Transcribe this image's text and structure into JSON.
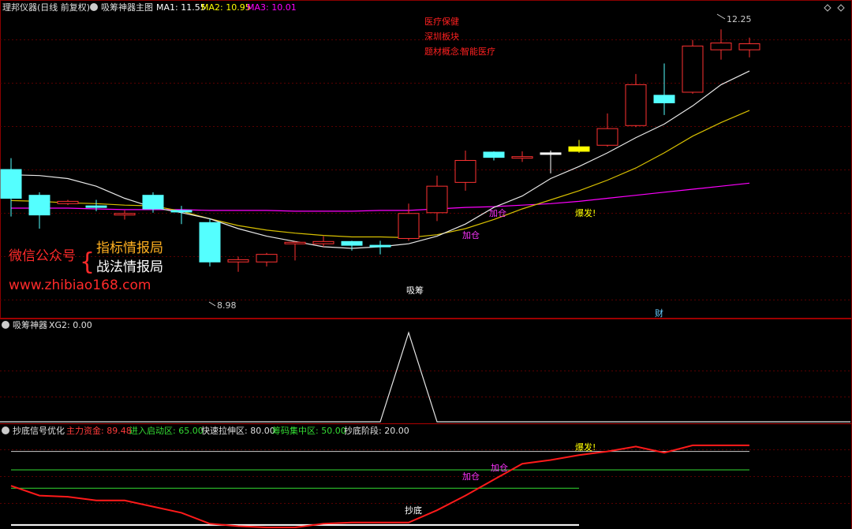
{
  "header": {
    "title": "理邦仪器(日线 前复权)",
    "indicator": "吸筹神器主图",
    "ma1": {
      "label": "MA1: 11.55",
      "color": "#ffffff"
    },
    "ma2": {
      "label": "MA2: 10.95",
      "color": "#ffff00"
    },
    "ma3": {
      "label": "MA3: 10.01",
      "color": "#ff00ff"
    }
  },
  "concepts": [
    "医疗保健",
    "深圳板块",
    "智能医疗"
  ],
  "concept_prefix": "题材概念:",
  "watermark": {
    "line1": "微信公众号",
    "brace": "{",
    "line2a": "指标情报局",
    "line2b": "战法情报局",
    "url": "www.zhibiao168.com"
  },
  "price_labels": {
    "high": "12.25",
    "low": "8.98"
  },
  "signals": {
    "xichou": "吸筹",
    "jiacang": "加仓",
    "baofa": "爆发!",
    "cai": "财",
    "chaodi": "抄底"
  },
  "panel2": {
    "title": "吸筹神器",
    "xg2": "XG2: 0.00"
  },
  "panel3": {
    "title": "抄底信号优化",
    "items": [
      {
        "label": "主力资金: 89.48",
        "color": "#ff3b3b"
      },
      {
        "label": "进入启动区: 65.00",
        "color": "#33dd33"
      },
      {
        "label": "快速拉伸区: 80.00",
        "color": "#e0e0e0"
      },
      {
        "label": "筹码集中区: 50.00",
        "color": "#33dd33"
      },
      {
        "label": "抄底阶段: 20.00",
        "color": "#e0e0e0"
      }
    ]
  },
  "chart_data": [
    {
      "type": "candlestick",
      "title": "理邦仪器(日线 前复权)",
      "ylim": [
        8.6,
        12.45
      ],
      "candles": [
        {
          "o": 10.4,
          "c": 10.02,
          "h": 10.55,
          "l": 9.78,
          "color": "cyan"
        },
        {
          "o": 10.06,
          "c": 9.8,
          "h": 10.1,
          "l": 9.62,
          "color": "cyan"
        },
        {
          "o": 9.95,
          "c": 9.98,
          "h": 10.0,
          "l": 9.93,
          "color": "red"
        },
        {
          "o": 9.92,
          "c": 9.9,
          "h": 10.0,
          "l": 9.85,
          "color": "cyan"
        },
        {
          "o": 9.82,
          "c": 9.82,
          "h": 9.86,
          "l": 9.74,
          "color": "red"
        },
        {
          "o": 10.06,
          "c": 9.88,
          "h": 10.1,
          "l": 9.83,
          "color": "cyan"
        },
        {
          "o": 9.86,
          "c": 9.84,
          "h": 9.92,
          "l": 9.68,
          "color": "cyan"
        },
        {
          "o": 9.7,
          "c": 9.18,
          "h": 9.75,
          "l": 9.12,
          "color": "cyan"
        },
        {
          "o": 9.18,
          "c": 9.21,
          "h": 9.25,
          "l": 9.05,
          "color": "red"
        },
        {
          "o": 9.18,
          "c": 9.28,
          "h": 9.3,
          "l": 9.12,
          "color": "red"
        },
        {
          "o": 9.42,
          "c": 9.44,
          "h": 9.45,
          "l": 9.2,
          "color": "red"
        },
        {
          "o": 9.42,
          "c": 9.45,
          "h": 9.52,
          "l": 9.38,
          "color": "red"
        },
        {
          "o": 9.45,
          "c": 9.4,
          "h": 9.46,
          "l": 9.33,
          "color": "cyan"
        },
        {
          "o": 9.4,
          "c": 9.4,
          "h": 9.46,
          "l": 9.28,
          "color": "cyan"
        },
        {
          "o": 9.49,
          "c": 9.82,
          "h": 9.95,
          "l": 9.46,
          "color": "red"
        },
        {
          "o": 9.83,
          "c": 10.18,
          "h": 10.32,
          "l": 9.72,
          "color": "red"
        },
        {
          "o": 10.23,
          "c": 10.52,
          "h": 10.65,
          "l": 10.12,
          "color": "red"
        },
        {
          "o": 10.63,
          "c": 10.56,
          "h": 10.64,
          "l": 10.52,
          "color": "cyan"
        },
        {
          "o": 10.55,
          "c": 10.57,
          "h": 10.64,
          "l": 10.5,
          "color": "red"
        },
        {
          "o": 10.62,
          "c": 10.62,
          "h": 10.65,
          "l": 10.35,
          "color": "white"
        },
        {
          "o": 10.7,
          "c": 10.64,
          "h": 10.79,
          "l": 10.62,
          "color": "yellow"
        },
        {
          "o": 10.72,
          "c": 10.94,
          "h": 11.14,
          "l": 10.7,
          "color": "red"
        },
        {
          "o": 10.98,
          "c": 11.52,
          "h": 11.66,
          "l": 10.96,
          "color": "red"
        },
        {
          "o": 11.38,
          "c": 11.28,
          "h": 11.8,
          "l": 11.12,
          "color": "cyan"
        },
        {
          "o": 11.42,
          "c": 12.03,
          "h": 12.11,
          "l": 11.4,
          "color": "red"
        },
        {
          "o": 11.98,
          "c": 12.07,
          "h": 12.25,
          "l": 11.85,
          "color": "red"
        },
        {
          "o": 11.98,
          "c": 12.06,
          "h": 12.14,
          "l": 11.88,
          "color": "red"
        }
      ],
      "ma1": [
        10.33,
        10.32,
        10.28,
        10.18,
        10.02,
        9.9,
        9.83,
        9.75,
        9.62,
        9.52,
        9.45,
        9.38,
        9.36,
        9.38,
        9.42,
        9.52,
        9.68,
        9.9,
        10.05,
        10.28,
        10.44,
        10.62,
        10.82,
        11.0,
        11.24,
        11.52,
        11.7
      ],
      "ma2": [
        9.99,
        9.98,
        9.96,
        9.95,
        9.93,
        9.92,
        9.85,
        9.75,
        9.66,
        9.6,
        9.56,
        9.53,
        9.51,
        9.51,
        9.5,
        9.54,
        9.62,
        9.74,
        9.88,
        10.0,
        10.12,
        10.26,
        10.42,
        10.62,
        10.84,
        11.02,
        11.18
      ],
      "ma3": [
        9.89,
        9.89,
        9.89,
        9.88,
        9.87,
        9.87,
        9.87,
        9.86,
        9.86,
        9.86,
        9.85,
        9.85,
        9.85,
        9.86,
        9.86,
        9.88,
        9.9,
        9.91,
        9.93,
        9.95,
        9.98,
        10.02,
        10.06,
        10.1,
        10.14,
        10.18,
        10.22
      ]
    },
    {
      "type": "line",
      "title": "吸筹神器",
      "ylim": [
        0,
        1
      ],
      "values": [
        0,
        0,
        0,
        0,
        0,
        0,
        0,
        0,
        0,
        0,
        0,
        0,
        0,
        0,
        1,
        0,
        0,
        0,
        0,
        0,
        0,
        0,
        0,
        0,
        0,
        0,
        0
      ]
    },
    {
      "type": "line",
      "title": "抄底信号优化",
      "ylim": [
        18,
        92
      ],
      "levels": [
        {
          "value": 80,
          "color": "#cccccc",
          "to_bar": 26
        },
        {
          "value": 65,
          "color": "#33dd33",
          "to_bar": 26
        },
        {
          "value": 50,
          "color": "#33dd33",
          "to_bar": 20
        },
        {
          "value": 20,
          "color": "#ffffff",
          "to_bar": 20
        }
      ],
      "values": [
        52,
        44,
        43,
        40,
        40,
        35,
        30,
        21,
        19,
        18,
        18,
        21,
        22,
        22,
        22,
        32,
        44,
        57,
        70,
        73,
        77,
        80,
        84,
        79,
        85,
        85,
        85
      ]
    }
  ]
}
